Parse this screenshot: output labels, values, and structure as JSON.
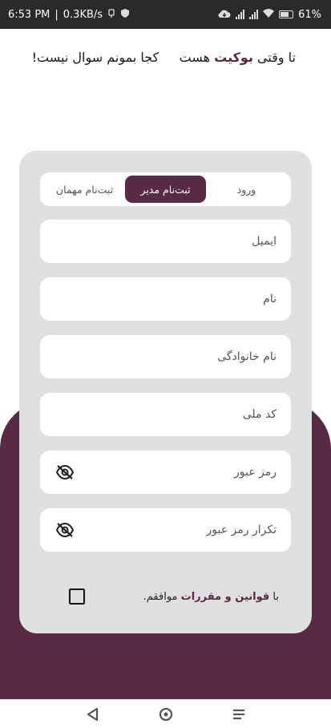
{
  "status_bar": {
    "time": "6:53 PM",
    "net_speed": "0.3KB/s",
    "battery": "61%",
    "icons": [
      "usb-icon",
      "shield-icon",
      "cloud-download-icon",
      "signal-icon",
      "signal-icon",
      "wifi-icon",
      "battery-icon"
    ]
  },
  "headline": {
    "prefix": "تا وقتی ",
    "brand": "بوکیت",
    "suffix": " هست     کجا بمونم سوال نیست!"
  },
  "colors": {
    "accent": "#582a45",
    "card": "#e0e0e0",
    "field": "#ffffff"
  },
  "tabs": [
    {
      "label": "ورود",
      "active": false
    },
    {
      "label": "ثبت‌نام مدیر",
      "active": true
    },
    {
      "label": "ثبت‌نام مهمان",
      "active": false
    }
  ],
  "fields": {
    "email": {
      "placeholder": "ایمیل",
      "value": ""
    },
    "first_name": {
      "placeholder": "نام",
      "value": ""
    },
    "last_name": {
      "placeholder": "نام خانوادگی",
      "value": ""
    },
    "national_code": {
      "placeholder": "کد ملی",
      "value": ""
    },
    "password": {
      "placeholder": "رمز عبور",
      "value": "",
      "icon": "eye-off-icon"
    },
    "password_confirm": {
      "placeholder": "تکرار رمز عبور",
      "value": "",
      "icon": "eye-off-icon"
    }
  },
  "terms": {
    "prefix": "با ",
    "link": "قوانین و مقررات",
    "suffix": " موافقم.",
    "checked": false
  },
  "nav": {
    "icons": [
      "back-icon",
      "home-icon",
      "menu-icon"
    ]
  }
}
